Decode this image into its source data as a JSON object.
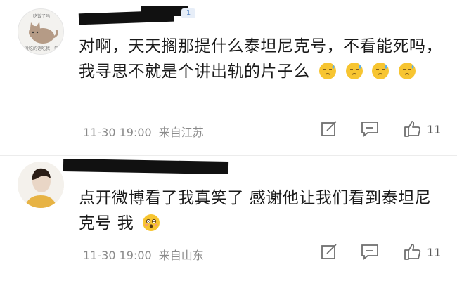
{
  "comments": [
    {
      "avatar_caption_top": "吃饭了吗",
      "avatar_caption_bottom": "没吃的话吃我一拳",
      "vip_badge": "1",
      "text": "对啊，天天搁那提什么泰坦尼克号，不看能死吗，我寻思不就是个讲出轨的片子么",
      "time": "11-30 19:00",
      "location": "来自江苏",
      "likes": "11"
    },
    {
      "text": "点开微博看了我真笑了 感谢他让我们看到泰坦尼克号 我",
      "time": "11-30 19:00",
      "location": "来自山东",
      "likes": "11"
    }
  ],
  "colors": {
    "text": "#1a1a1a",
    "meta": "#8a8a8a",
    "icon": "#6f6f6f",
    "redaction": "#111111",
    "emoji": "#f7c531"
  },
  "icons": [
    "edit-icon",
    "comment-icon",
    "thumbs-up-icon",
    "sweat-emoji-icon",
    "flushed-emoji-icon"
  ]
}
